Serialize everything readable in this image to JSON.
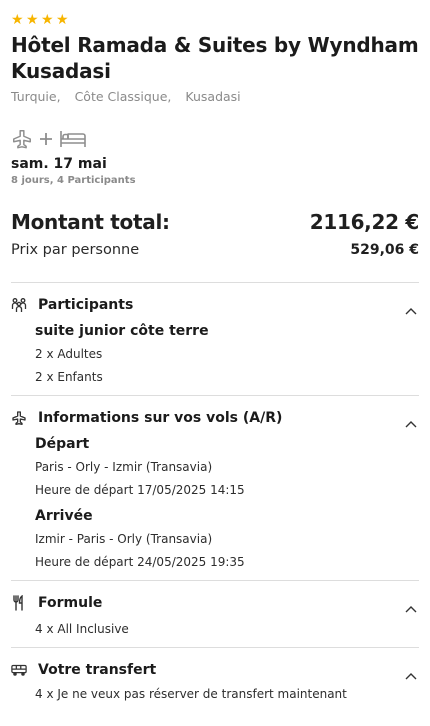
{
  "hotel": {
    "star_count": 4,
    "name": "Hôtel Ramada & Suites by Wyndham Kusadasi",
    "location": [
      "Turquie,",
      "Côte Classique,",
      "Kusadasi"
    ]
  },
  "trip": {
    "date": "sam. 17 mai",
    "summary": "8 jours, 4 Participants",
    "icons": [
      "plane-icon",
      "plus-icon",
      "bed-icon"
    ]
  },
  "totals": {
    "total_label": "Montant total:",
    "total_value": "2116,22 €",
    "per_person_label": "Prix par personne",
    "per_person_value": "529,06 €"
  },
  "sections": {
    "participants": {
      "title": "Participants",
      "icon": "people-icon",
      "room": "suite junior côte terre",
      "adults": "2 x Adultes",
      "children": "2 x Enfants"
    },
    "flights": {
      "title": "Informations sur vos vols (A/R)",
      "icon": "plane-icon",
      "departure_title": "Départ",
      "departure_route": "Paris - Orly - Izmir (Transavia)",
      "departure_time": "Heure de départ 17/05/2025 14:15",
      "arrival_title": "Arrivée",
      "arrival_route": "Izmir - Paris - Orly (Transavia)",
      "arrival_time": "Heure de départ 24/05/2025 19:35"
    },
    "formule": {
      "title": "Formule",
      "icon": "cutlery-icon",
      "value": "4 x All Inclusive"
    },
    "transfer": {
      "title": "Votre transfert",
      "icon": "bus-icon",
      "value": "4 x Je ne veux pas réserver de transfert maintenant"
    }
  },
  "colors": {
    "star": "#f7b500",
    "muted": "#8a8a8a",
    "divider": "#dddddd"
  }
}
